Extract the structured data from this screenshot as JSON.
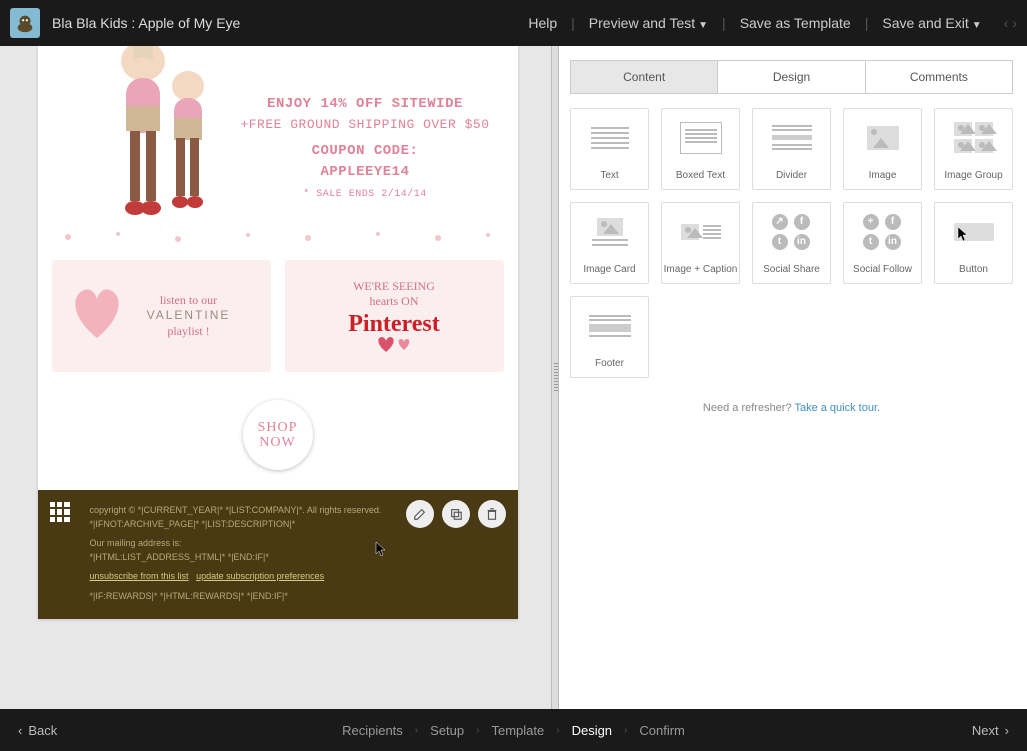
{
  "topbar": {
    "title": "Bla Bla Kids : Apple of My Eye",
    "help": "Help",
    "preview": "Preview and Test",
    "saveTemplate": "Save as Template",
    "saveExit": "Save and Exit"
  },
  "promo": {
    "line1": "ENJOY 14% OFF SITEWIDE",
    "line2": "+FREE GROUND SHIPPING OVER $50",
    "codeLabel": "COUPON CODE:",
    "code": "APPLEEYE14",
    "ends": "* SALE ENDS 2/14/14"
  },
  "cardPlaylist": {
    "line1": "listen to our",
    "line2": "VALENTINE",
    "line3": "playlist !"
  },
  "cardPinterest": {
    "line1": "WE'RE SEEING",
    "line2": "hearts ON",
    "brand": "Pinterest"
  },
  "shop": {
    "l1": "SHOP",
    "l2": "NOW"
  },
  "footerBlock": {
    "l1": "copyright © *|CURRENT_YEAR|* *|LIST:COMPANY|*. All rights reserved.",
    "l2": "*|IFNOT:ARCHIVE_PAGE|* *|LIST:DESCRIPTION|*",
    "l3": "Our mailing address is:",
    "l4": "*|HTML:LIST_ADDRESS_HTML|* *|END:IF|*",
    "l5a": "unsubscribe from this list",
    "l5b": "update subscription preferences",
    "l6": "*|IF:REWARDS|* *|HTML:REWARDS|* *|END:IF|*"
  },
  "rightPanel": {
    "tabs": {
      "content": "Content",
      "design": "Design",
      "comments": "Comments"
    },
    "blocks": [
      "Text",
      "Boxed Text",
      "Divider",
      "Image",
      "Image Group",
      "Image Card",
      "Image + Caption",
      "Social Share",
      "Social Follow",
      "Button",
      "Footer"
    ],
    "hint1": "Need a refresher? ",
    "hintLink": "Take a quick tour."
  },
  "bottombar": {
    "back": "Back",
    "steps": [
      "Recipients",
      "Setup",
      "Template",
      "Design",
      "Confirm"
    ],
    "activeStep": "Design",
    "next": "Next"
  }
}
